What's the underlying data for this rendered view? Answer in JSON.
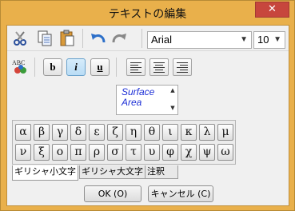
{
  "window": {
    "title": "テキストの編集",
    "close_glyph": "✕"
  },
  "toolbar": {
    "font": "Arial",
    "size": "10",
    "bold_label": "b",
    "italic_label": "i",
    "underline_label": "u"
  },
  "preview": {
    "lines": [
      "Surface",
      "Area"
    ]
  },
  "greek": {
    "row1": [
      "α",
      "β",
      "γ",
      "δ",
      "ε",
      "ζ",
      "η",
      "θ",
      "ι",
      "κ",
      "λ",
      "μ"
    ],
    "row2": [
      "ν",
      "ξ",
      "ο",
      "π",
      "ρ",
      "σ",
      "τ",
      "υ",
      "φ",
      "χ",
      "ψ",
      "ω"
    ]
  },
  "tabs": {
    "lowercase": "ギリシャ小文字",
    "uppercase": "ギリシャ大文字",
    "notes": "注釈"
  },
  "buttons": {
    "ok": "OK (O)",
    "cancel": "キャンセル (C)"
  }
}
